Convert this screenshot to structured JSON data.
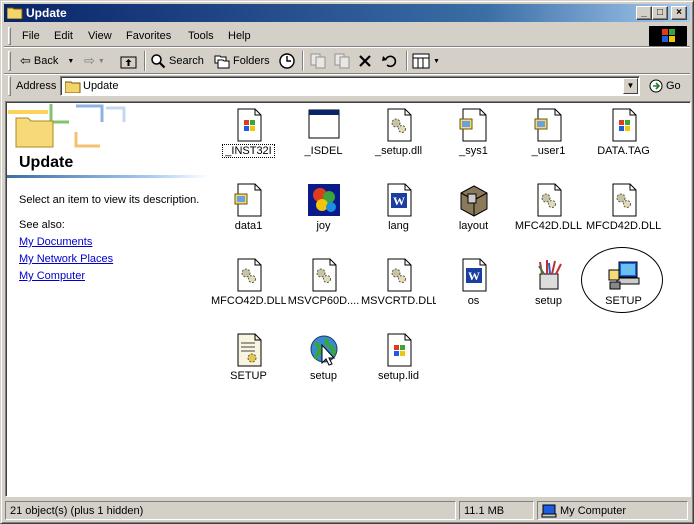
{
  "window": {
    "title": "Update",
    "controls": [
      "_",
      "□",
      "×"
    ]
  },
  "menu": [
    "File",
    "Edit",
    "View",
    "Favorites",
    "Tools",
    "Help"
  ],
  "toolbar": {
    "back": "Back",
    "search": "Search",
    "folders": "Folders"
  },
  "address": {
    "label": "Address",
    "value": "Update",
    "go": "Go"
  },
  "left_pane": {
    "title": "Update",
    "description": "Select an item to view its description.",
    "see_also": "See also:",
    "links": [
      "My Documents",
      "My Network Places",
      "My Computer"
    ]
  },
  "files": [
    {
      "name": "_INST32I",
      "icon": "exe-window-icon"
    },
    {
      "name": "_ISDEL",
      "icon": "app-window-icon"
    },
    {
      "name": "_setup.dll",
      "icon": "dll-gear-icon"
    },
    {
      "name": "_sys1",
      "icon": "installshield-file-icon"
    },
    {
      "name": "_user1",
      "icon": "installshield-file-icon"
    },
    {
      "name": "DATA.TAG",
      "icon": "windows-file-icon"
    },
    {
      "name": "data1",
      "icon": "installshield-file-icon"
    },
    {
      "name": "joy",
      "icon": "bitmap-image-icon"
    },
    {
      "name": "lang",
      "icon": "word-document-icon"
    },
    {
      "name": "layout",
      "icon": "cube-box-icon"
    },
    {
      "name": "MFC42D.DLL",
      "icon": "dll-gear-icon"
    },
    {
      "name": "MFCD42D.DLL",
      "icon": "dll-gear-icon"
    },
    {
      "name": "MFCO42D.DLL",
      "icon": "dll-gear-icon"
    },
    {
      "name": "MSVCP60D....",
      "icon": "dll-gear-icon"
    },
    {
      "name": "MSVCRTD.DLL",
      "icon": "dll-gear-icon"
    },
    {
      "name": "os",
      "icon": "word-document-icon"
    },
    {
      "name": "setup",
      "icon": "setup-tools-icon"
    },
    {
      "name": "SETUP",
      "icon": "setup-computer-icon"
    },
    {
      "name": "SETUP",
      "icon": "settings-file-icon"
    },
    {
      "name": "setup",
      "icon": "globe-cursor-icon"
    },
    {
      "name": "setup.lid",
      "icon": "windows-file-icon"
    }
  ],
  "status": {
    "objects": "21 object(s) (plus 1 hidden)",
    "size": "11.1 MB",
    "zone": "My Computer"
  },
  "colors": {
    "title_bar": "#0a246a",
    "face": "#d4d0c8",
    "link": "#0000cc"
  }
}
